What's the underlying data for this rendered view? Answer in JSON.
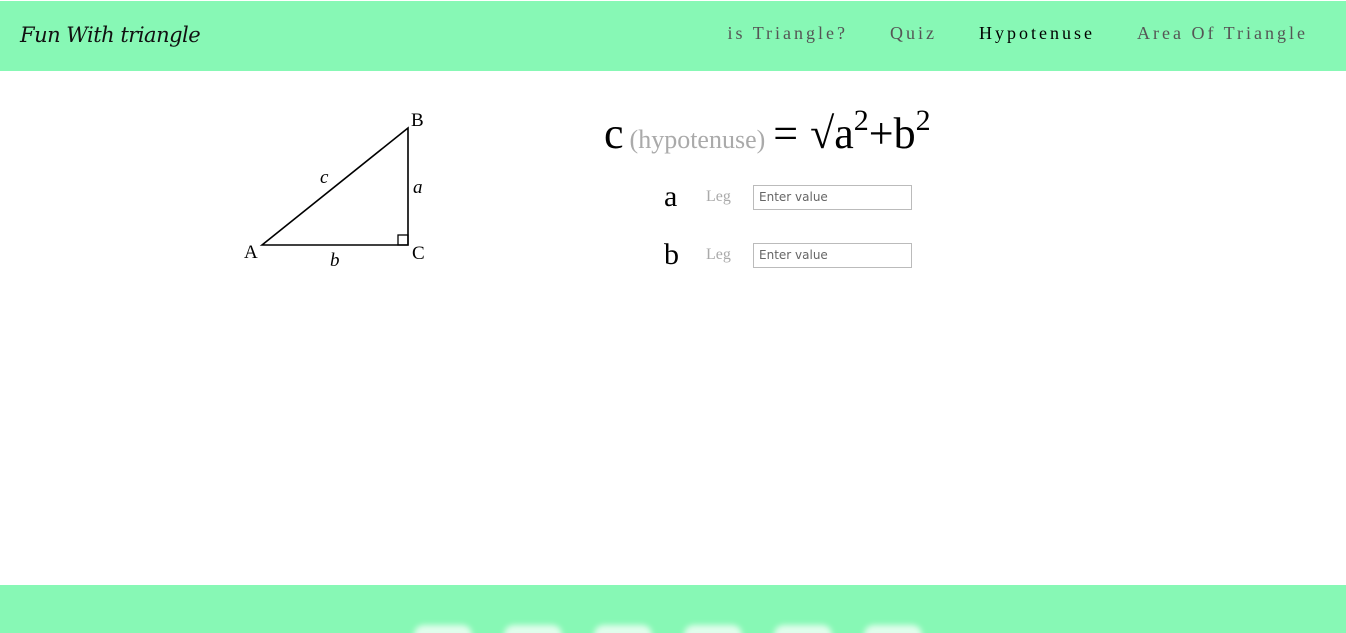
{
  "header": {
    "brand": "Fun With triangle",
    "nav": [
      {
        "label": "is Triangle?"
      },
      {
        "label": "Quiz"
      },
      {
        "label": "Hypotenuse",
        "active": true
      },
      {
        "label": "Area Of Triangle"
      }
    ]
  },
  "diagram": {
    "vertex_a": "A",
    "vertex_b": "B",
    "vertex_c": "C",
    "side_a": "a",
    "side_b": "b",
    "side_c": "c"
  },
  "formula": {
    "c": "c",
    "hypotenuse_hint": "(hypotenuse)",
    "equals": "=",
    "sqrt_a": "√a",
    "exp_a": "2",
    "plus_b": "+b",
    "exp_b": "2"
  },
  "inputs": {
    "a": {
      "variable": "a",
      "hint": "Leg",
      "value": "",
      "placeholder": "Enter value"
    },
    "b": {
      "variable": "b",
      "hint": "Leg",
      "value": "",
      "placeholder": "Enter value"
    }
  },
  "colors": {
    "header_bg": "#87f8b5",
    "footer_bg": "#87f8b5",
    "hint_text": "#aaaaaa"
  },
  "footer": {
    "icons": [
      "social-icon",
      "social-icon",
      "social-icon",
      "social-icon",
      "social-icon",
      "social-icon"
    ]
  }
}
